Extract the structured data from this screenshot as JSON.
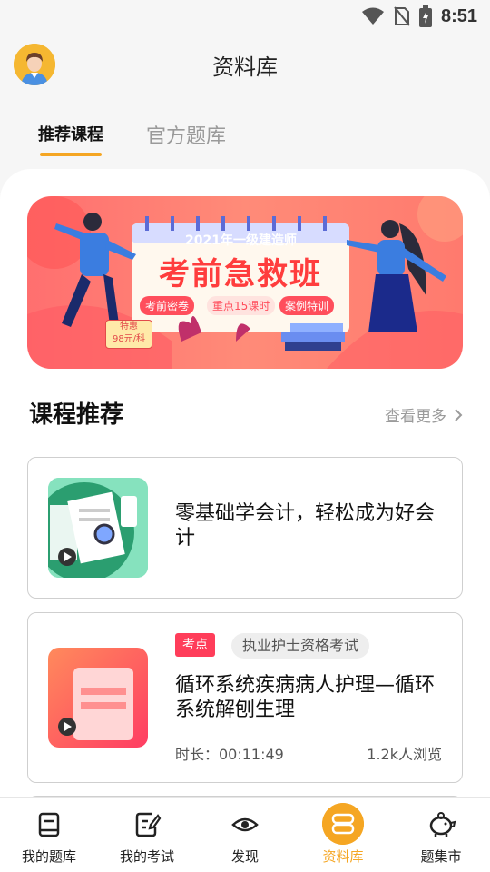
{
  "status": {
    "time": "8:51"
  },
  "header": {
    "title": "资料库"
  },
  "tabs": [
    {
      "label": "推荐课程",
      "active": true
    },
    {
      "label": "官方题库",
      "active": false
    }
  ],
  "banner": {
    "subtitle": "2021年一级建造师",
    "title": "考前急救班",
    "chips": [
      "考前密卷",
      "重点15课时",
      "案例特训"
    ],
    "price_badge_line1": "特惠",
    "price_badge_line2": "98元/科"
  },
  "section": {
    "title": "课程推荐",
    "more_label": "查看更多"
  },
  "courses": [
    {
      "title": "零基础学会计，轻松成为好会计"
    },
    {
      "tag": "考点",
      "category": "执业护士资格考试",
      "title": "循环系统疾病病人护理—循环系统解刨生理",
      "duration": "时长：00:11:49",
      "views": "1.2k人浏览"
    }
  ],
  "nav": [
    {
      "label": "我的题库",
      "icon": "book-icon"
    },
    {
      "label": "我的考试",
      "icon": "exam-edit-icon"
    },
    {
      "label": "发现",
      "icon": "eye-icon"
    },
    {
      "label": "资料库",
      "icon": "library-icon",
      "active": true
    },
    {
      "label": "题集市",
      "icon": "piggy-bank-icon"
    }
  ],
  "colors": {
    "accent": "#f5a623",
    "tag_red": "#ff3d5a",
    "banner": "#ff7a6e"
  }
}
